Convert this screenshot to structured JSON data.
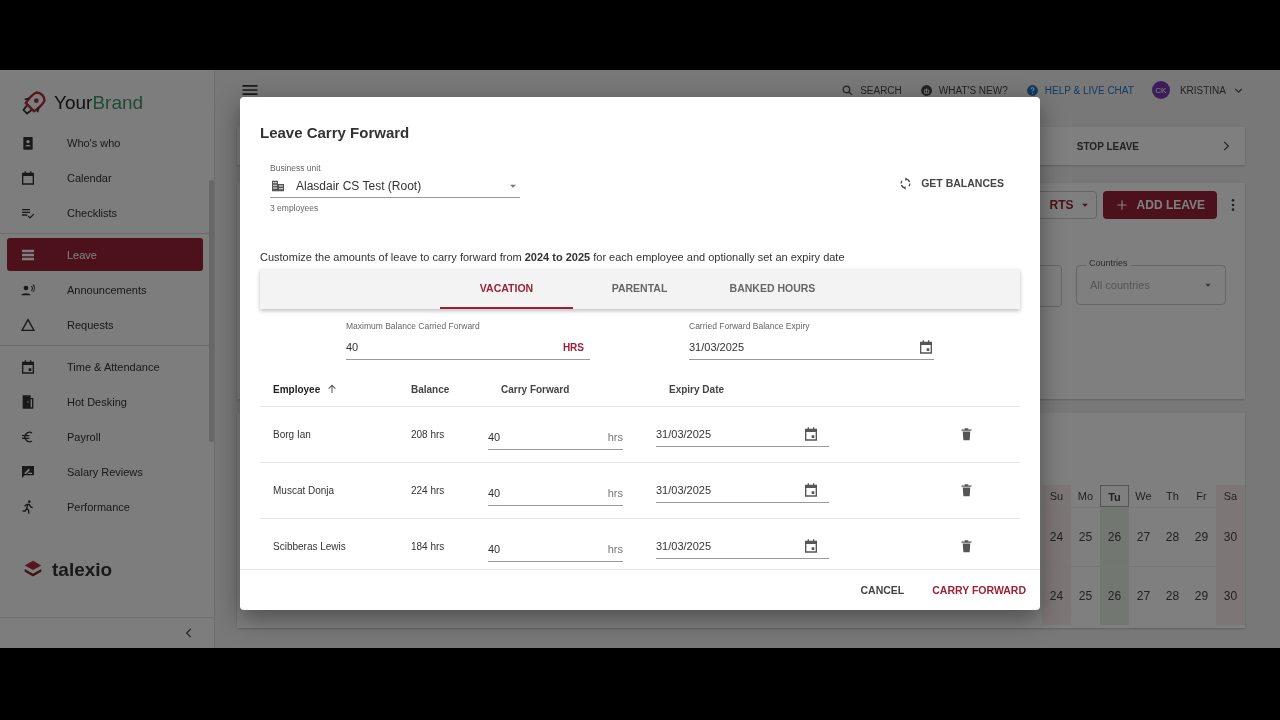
{
  "sidebar": {
    "brand": {
      "name_start": "Your",
      "name_end": "Brand"
    },
    "groups": [
      [
        {
          "label": "Who's who",
          "selected": false
        },
        {
          "label": "Calendar",
          "selected": false
        },
        {
          "label": "Checklists",
          "selected": false
        }
      ],
      [
        {
          "label": "Leave",
          "selected": true
        },
        {
          "label": "Announcements",
          "selected": false
        },
        {
          "label": "Requests",
          "selected": false
        }
      ],
      [
        {
          "label": "Time & Attendance",
          "selected": false
        },
        {
          "label": "Hot Desking",
          "selected": false
        },
        {
          "label": "Payroll",
          "selected": false
        },
        {
          "label": "Salary Reviews",
          "selected": false
        },
        {
          "label": "Performance",
          "selected": false
        }
      ]
    ],
    "footer_logo": "talexio"
  },
  "header": {
    "actions": [
      {
        "kind": "search",
        "label": "SEARCH"
      },
      {
        "kind": "news",
        "label": "WHAT'S NEW?"
      },
      {
        "kind": "help",
        "label": "HELP & LIVE CHAT"
      }
    ],
    "user": {
      "initials": "CK",
      "name": "KRISTINA"
    }
  },
  "stop_leave": {
    "label": "STOP LEAVE"
  },
  "toolbar": {
    "reports_partial": "RTS",
    "add_button": "ADD LEAVE"
  },
  "filters": {
    "countries": {
      "label": "Countries",
      "placeholder": "All countries"
    }
  },
  "calendar": {
    "days": [
      {
        "label": "Su",
        "kind": "weekend"
      },
      {
        "label": "Mo",
        "kind": "weekday"
      },
      {
        "label": "Tu",
        "kind": "today"
      },
      {
        "label": "We",
        "kind": "weekday"
      },
      {
        "label": "Th",
        "kind": "weekday"
      },
      {
        "label": "Fr",
        "kind": "weekday"
      },
      {
        "label": "Sa",
        "kind": "weekend"
      }
    ],
    "rows": [
      [
        "24",
        "25",
        "26",
        "27",
        "28",
        "29",
        "30"
      ],
      [
        "24",
        "25",
        "26",
        "27",
        "28",
        "29",
        "30"
      ]
    ]
  },
  "dialog": {
    "title": "Leave Carry Forward",
    "business_unit": {
      "label": "Business unit",
      "value": "Alasdair CS Test (Root)",
      "helper": "3 employees"
    },
    "get_balances": "GET BALANCES",
    "description": "Customize the amounts of leave to carry forward from **2024 to 2025** for each employee and optionally set an expiry date",
    "tabs": [
      {
        "label": "VACATION",
        "selected": true
      },
      {
        "label": "PARENTAL",
        "selected": false
      },
      {
        "label": "BANKED HOURS",
        "selected": false
      }
    ],
    "max_balance": {
      "label": "Maximum Balance Carried Forward",
      "value": "40",
      "unit": "HRS"
    },
    "expiry": {
      "label": "Carried Forward Balance Expiry",
      "value": "31/03/2025"
    },
    "table": {
      "columns": [
        {
          "label": "Employee",
          "sorted_ascending": true
        },
        {
          "label": "Balance",
          "sorted_ascending": false
        },
        {
          "label": "Carry Forward",
          "sorted_ascending": false
        },
        {
          "label": "Expiry Date",
          "sorted_ascending": false
        }
      ],
      "rows": [
        {
          "employee": "Borg Ian",
          "balance": "208 hrs",
          "carry_forward": "40",
          "unit": "hrs",
          "expiry": "31/03/2025"
        },
        {
          "employee": "Muscat Donja",
          "balance": "224 hrs",
          "carry_forward": "40",
          "unit": "hrs",
          "expiry": "31/03/2025"
        },
        {
          "employee": "Scibberas Lewis",
          "balance": "184 hrs",
          "carry_forward": "40",
          "unit": "hrs",
          "expiry": "31/03/2025"
        }
      ]
    },
    "buttons": [
      {
        "label": "CANCEL",
        "kind": "secondary"
      },
      {
        "label": "CARRY FORWARD",
        "kind": "primary"
      }
    ]
  }
}
